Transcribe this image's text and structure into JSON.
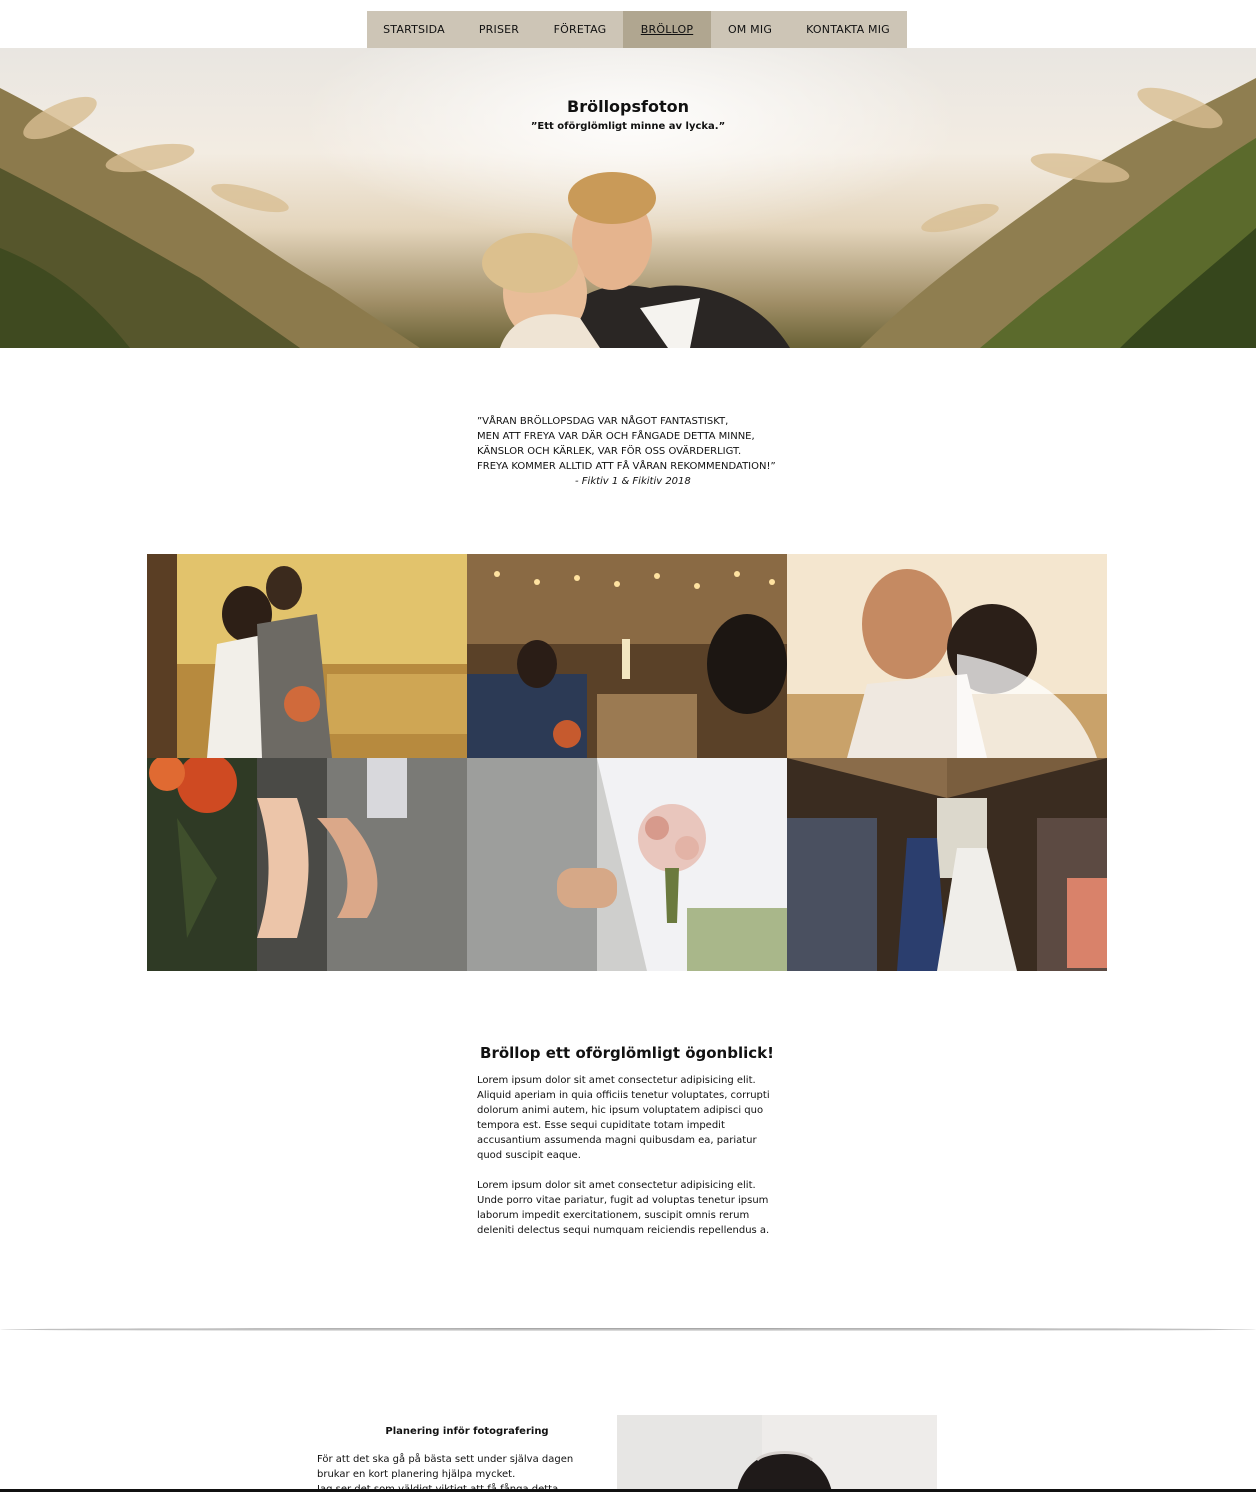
{
  "nav": {
    "items": [
      {
        "label": "STARTSIDA",
        "active": false
      },
      {
        "label": "PRISER",
        "active": false
      },
      {
        "label": "FÖRETAG",
        "active": false
      },
      {
        "label": "BRÖLLOP",
        "active": true
      },
      {
        "label": "OM MIG",
        "active": false
      },
      {
        "label": "KONTAKTA MIG",
        "active": false
      }
    ]
  },
  "hero": {
    "title": "Bröllopsfoton",
    "subtitle": "”Ett oförglömligt minne av lycka.”"
  },
  "testimonial": {
    "lines": [
      "”VÅRAN BRÖLLOPSDAG VAR NÅGOT FANTASTISKT,",
      "MEN ATT FREYA VAR DÄR OCH FÅNGADE DETTA MINNE,",
      "KÄNSLOR OCH KÄRLEK, VAR FÖR OSS OVÄRDERLIGT.",
      "FREYA KOMMER ALLTID ATT FÅ VÅRAN REKOMMENDATION!”"
    ],
    "author": "- Fiktiv 1 & Fikitiv 2018"
  },
  "info": {
    "title": "Bröllop ett oförglömligt ögonblick!",
    "paragraphs": [
      "Lorem ipsum dolor sit amet consectetur adipisicing elit. Aliquid aperiam in quia officiis tenetur voluptates, corrupti dolorum animi autem, hic ipsum voluptatem adipisci quo tempora est. Esse sequi cupiditate totam impedit accusantium assumenda magni quibusdam ea, pariatur quod suscipit eaque.",
      "Lorem ipsum dolor sit amet consectetur adipisicing elit. Unde porro vitae pariatur, fugit ad voluptas tenetur ipsum laborum impedit exercitationem, suscipit omnis rerum deleniti delectus sequi numquam reiciendis repellendus a."
    ]
  },
  "planning": {
    "title": "Planering inför fotografering",
    "lines": [
      "För att det ska gå på bästa sett under själva dagen",
      "brukar en kort planering hjälpa mycket.",
      " Jag ser det som väldigt viktigt att få fånga detta"
    ]
  },
  "colors": {
    "nav_bg": "#cdc5b6",
    "nav_active": "#b0a690"
  }
}
